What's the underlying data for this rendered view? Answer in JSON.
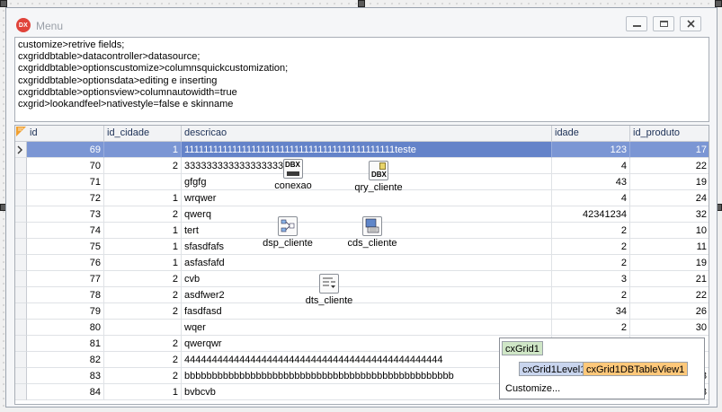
{
  "window": {
    "title": "Menu",
    "app_icon_label": "DX"
  },
  "memo": {
    "lines": [
      "customize>retrive fields;",
      "cxgriddbtable>datacontroller>datasource;",
      "cxgriddbtable>optionscustomize>columnsquickcustomization;",
      "cxgriddbtable>optionsdata>editing e inserting",
      "cxgriddbtable>optionsview>columnautowidth=true",
      "cxgrid>lookandfeel>nativestyle=false e skinname"
    ]
  },
  "grid": {
    "columns": [
      "id",
      "id_cidade",
      "descricao",
      "idade",
      "id_produto"
    ],
    "rows": [
      {
        "id": "69",
        "id_cidade": "1",
        "descricao": "11111111111111111111111111111111111111111111teste",
        "idade": "123",
        "id_produto": "17"
      },
      {
        "id": "70",
        "id_cidade": "2",
        "descricao": "333333333333333333",
        "idade": "4",
        "id_produto": "22"
      },
      {
        "id": "71",
        "id_cidade": "",
        "descricao": "gfgfg",
        "idade": "43",
        "id_produto": "19"
      },
      {
        "id": "72",
        "id_cidade": "1",
        "descricao": "wrqwer",
        "idade": "4",
        "id_produto": "24"
      },
      {
        "id": "73",
        "id_cidade": "2",
        "descricao": "qwerq",
        "idade": "42341234",
        "id_produto": "32"
      },
      {
        "id": "74",
        "id_cidade": "1",
        "descricao": "tert",
        "idade": "2",
        "id_produto": "10"
      },
      {
        "id": "75",
        "id_cidade": "1",
        "descricao": "sfasdfafs",
        "idade": "2",
        "id_produto": "11"
      },
      {
        "id": "76",
        "id_cidade": "1",
        "descricao": "asfasfafd",
        "idade": "2",
        "id_produto": "19"
      },
      {
        "id": "77",
        "id_cidade": "2",
        "descricao": "cvb",
        "idade": "3",
        "id_produto": "21"
      },
      {
        "id": "78",
        "id_cidade": "2",
        "descricao": "asdfwer2",
        "idade": "2",
        "id_produto": "22"
      },
      {
        "id": "79",
        "id_cidade": "2",
        "descricao": "fasdfasd",
        "idade": "34",
        "id_produto": "26"
      },
      {
        "id": "80",
        "id_cidade": "",
        "descricao": "wqer",
        "idade": "2",
        "id_produto": "30"
      },
      {
        "id": "81",
        "id_cidade": "2",
        "descricao": "qwerqwr",
        "idade": "",
        "id_produto": ""
      },
      {
        "id": "82",
        "id_cidade": "2",
        "descricao": "44444444444444444444444444444444444444444444444",
        "idade": "",
        "id_produto": ""
      },
      {
        "id": "83",
        "id_cidade": "2",
        "descricao": "bbbbbbbbbbbbbbbbbbbbbbbbbbbbbbbbbbbbbbbbbbbbbbbbb",
        "idade": "",
        "id_produto": "28"
      },
      {
        "id": "84",
        "id_cidade": "1",
        "descricao": "bvbcvb",
        "idade": "",
        "id_produto": "28"
      }
    ]
  },
  "components": {
    "conexao": {
      "label": "conexao",
      "icon": "dbx-connection-icon",
      "icon_text": "DBX"
    },
    "qry_cliente": {
      "label": "qry_cliente",
      "icon": "dbx-query-icon",
      "icon_text": "DBX"
    },
    "dsp_cliente": {
      "label": "dsp_cliente",
      "icon": "dataset-provider-icon"
    },
    "cds_cliente": {
      "label": "cds_cliente",
      "icon": "client-dataset-icon"
    },
    "dts_cliente": {
      "label": "dts_cliente",
      "icon": "datasource-icon"
    }
  },
  "navigator": {
    "root": "cxGrid1",
    "level": "cxGrid1Level1",
    "view": "cxGrid1DBTableView1",
    "customize_link": "Customize..."
  },
  "colors": {
    "selected_row": "#7b96d4",
    "header_text": "#1b2f55",
    "app_icon": "#e0433a",
    "view_node": "#ffc87a",
    "level_node": "#c9d5ee",
    "root_node": "#cfe6c6"
  }
}
